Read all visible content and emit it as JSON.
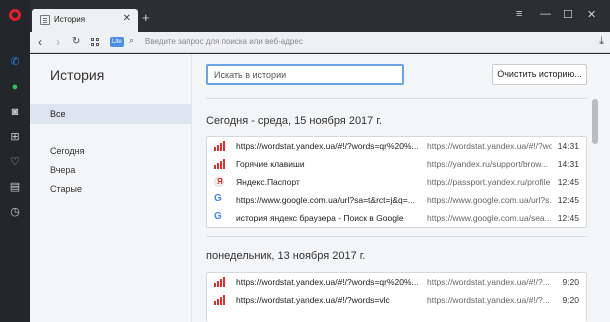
{
  "tab": {
    "title": "История"
  },
  "address": {
    "badge": "Lite",
    "placeholder": "Введите запрос для поиска или веб-адрес"
  },
  "sidebar": {
    "heading": "История",
    "selected": "Все",
    "items": [
      "Сегодня",
      "Вчера",
      "Старые"
    ]
  },
  "search": {
    "placeholder": "Искать в истории"
  },
  "clear_button": "Очистить историю...",
  "groups": [
    {
      "heading": "Сегодня - среда, 15 ноября 2017 г.",
      "rows": [
        {
          "icon": "wordstat-icon",
          "title": "https://wordstat.yandex.ua/#!/?words=qr%20%...",
          "url": "https://wordstat.yandex.ua/#!/?wo...",
          "time": "14:31"
        },
        {
          "icon": "wordstat-icon",
          "title": "Горячие клавиши",
          "url": "https://yandex.ru/support/brow...",
          "time": "14:31"
        },
        {
          "icon": "yandex-icon",
          "title": "Яндекс.Паспорт",
          "url": "https://passport.yandex.ru/profile",
          "time": "12:45"
        },
        {
          "icon": "google-icon",
          "title": "https://www.google.com.ua/url?sa=t&rct=j&q=...",
          "url": "https://www.google.com.ua/url?s...",
          "time": "12:45"
        },
        {
          "icon": "google-icon",
          "title": "история яндекс браузера - Поиск в Google",
          "url": "https://www.google.com.ua/sea...",
          "time": "12:45"
        }
      ]
    },
    {
      "heading": "понедельник, 13 ноября 2017 г.",
      "rows": [
        {
          "icon": "wordstat-icon",
          "title": "https://wordstat.yandex.ua/#!/?words=qr%20%...",
          "url": "https://wordstat.yandex.ua/#!/?...",
          "time": "9:20"
        },
        {
          "icon": "wordstat-icon",
          "title": "https://wordstat.yandex.ua/#!/?words=vlc",
          "url": "https://wordstat.yandex.ua/#!/?...",
          "time": "9:20"
        }
      ]
    }
  ]
}
